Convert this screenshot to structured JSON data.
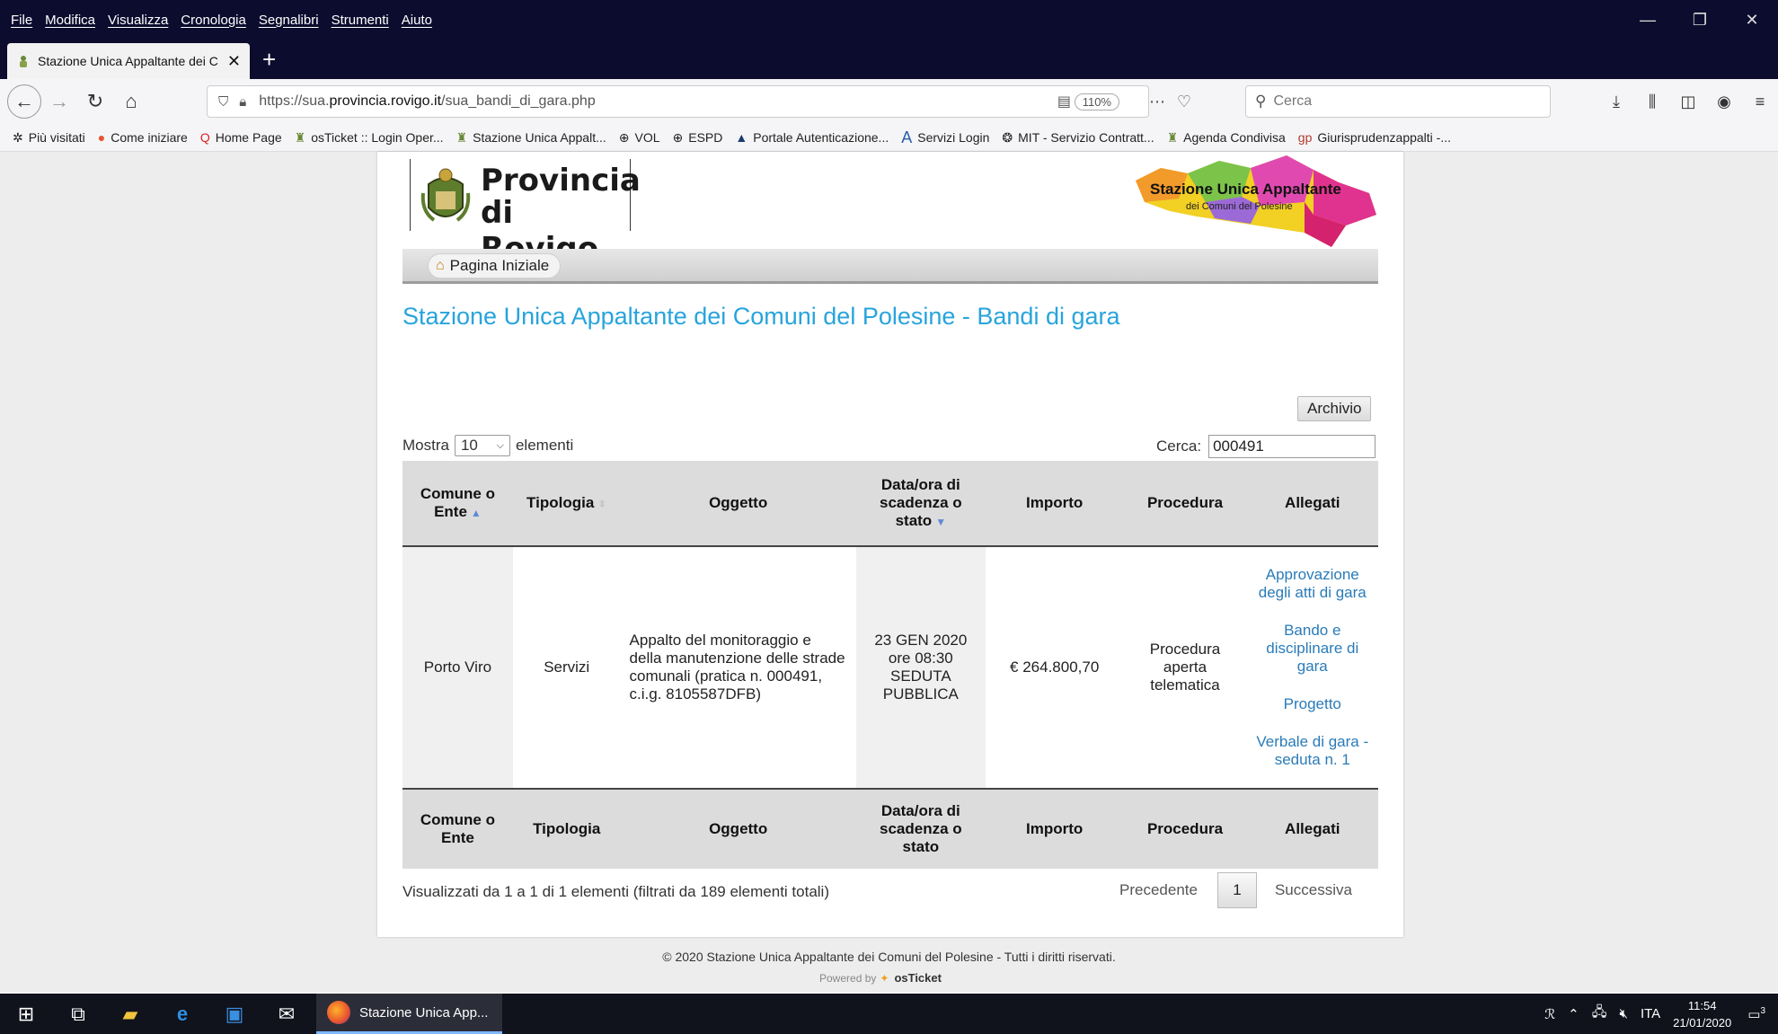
{
  "browser": {
    "menu": [
      "File",
      "Modifica",
      "Visualizza",
      "Cronologia",
      "Segnalibri",
      "Strumenti",
      "Aiuto"
    ],
    "tab_title": "Stazione Unica Appaltante dei C",
    "url_prefix": "https://sua.",
    "url_domain": "provincia.rovigo.it",
    "url_path": "/sua_bandi_di_gara.php",
    "zoom": "110%",
    "search_placeholder": "Cerca",
    "bookmarks": [
      {
        "icon": "gear-icon",
        "label": "Più visitati"
      },
      {
        "icon": "firefox-icon",
        "label": "Come iniziare"
      },
      {
        "icon": "q-icon",
        "label": "Home Page"
      },
      {
        "icon": "crest-icon",
        "label": "osTicket :: Login Oper..."
      },
      {
        "icon": "crest-icon",
        "label": "Stazione Unica Appalt..."
      },
      {
        "icon": "globe-icon",
        "label": "VOL"
      },
      {
        "icon": "globe-icon",
        "label": "ESPD"
      },
      {
        "icon": "tree-icon",
        "label": "Portale Autenticazione..."
      },
      {
        "icon": "a-icon",
        "label": "Servizi Login"
      },
      {
        "icon": "seal-icon",
        "label": "MIT - Servizio Contratt..."
      },
      {
        "icon": "crest-icon",
        "label": "Agenda Condivisa"
      },
      {
        "icon": "gp-icon",
        "label": "Giurisprudenzappalti -..."
      }
    ]
  },
  "page": {
    "logo_line1": "Provincia",
    "logo_line2": "di Rovigo",
    "sua_logo_line1": "Stazione Unica Appaltante",
    "sua_logo_line2": "dei Comuni del Polesine",
    "home_label": "Pagina Iniziale",
    "title": "Stazione Unica Appaltante dei Comuni del Polesine - Bandi di gara",
    "archivio_label": "Archivio",
    "show_label": "Mostra",
    "show_value": "10",
    "show_suffix": "elementi",
    "search_label": "Cerca:",
    "search_value": "000491",
    "columns": [
      "Comune o Ente",
      "Tipologia",
      "Oggetto",
      "Data/ora di scadenza o stato",
      "Importo",
      "Procedura",
      "Allegati"
    ],
    "row": {
      "comune": "Porto Viro",
      "tipologia": "Servizi",
      "oggetto": "Appalto del monitoraggio e della manutenzione delle strade comunali (pratica n. 000491, c.i.g. 8105587DFB)",
      "scadenza": "23 GEN 2020 ore 08:30 SEDUTA PUBBLICA",
      "importo": "€ 264.800,70",
      "procedura": "Procedura aperta telematica",
      "allegati": [
        "Approvazione degli atti di gara",
        "Bando e disciplinare di gara",
        "Progetto",
        "Verbale di gara - seduta n. 1"
      ]
    },
    "info": "Visualizzati da 1 a 1 di 1 elementi (filtrati da 189 elementi totali)",
    "prev_label": "Precedente",
    "current_page": "1",
    "next_label": "Successiva",
    "footer": "© 2020 Stazione Unica Appaltante dei Comuni del Polesine - Tutti i diritti riservati.",
    "powered_by": "Powered by",
    "powered_brand": "osTicket"
  },
  "taskbar": {
    "app_label": "Stazione Unica App...",
    "lang": "ITA",
    "time": "11:54",
    "date": "21/01/2020",
    "notifications": "3"
  }
}
